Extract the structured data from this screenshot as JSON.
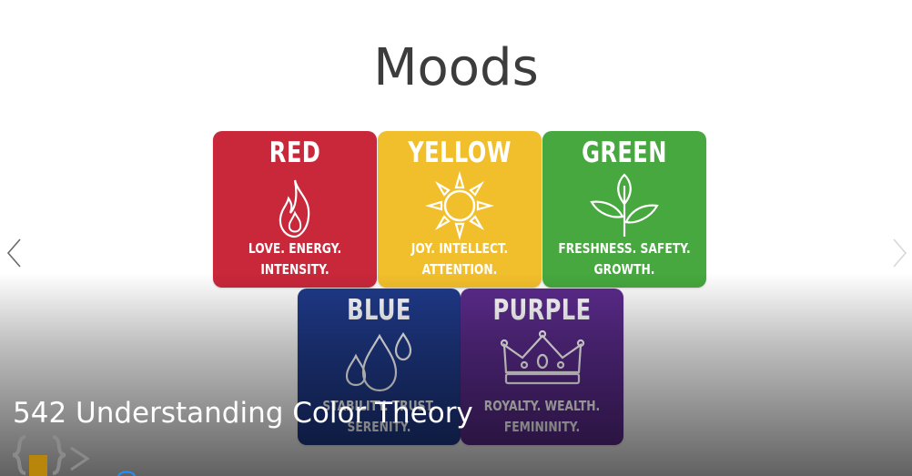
{
  "slide": {
    "title": "Moods",
    "tiles": [
      {
        "name": "RED",
        "desc_line1": "LOVE. ENERGY.",
        "desc_line2": "INTENSITY.",
        "color": "#c8283a",
        "icon": "flame-icon"
      },
      {
        "name": "YELLOW",
        "desc_line1": "JOY. INTELLECT.",
        "desc_line2": "ATTENTION.",
        "color": "#f2bf2c",
        "icon": "sun-icon"
      },
      {
        "name": "GREEN",
        "desc_line1": "FRESHNESS. SAFETY.",
        "desc_line2": "GROWTH.",
        "color": "#46a83e",
        "icon": "leaves-icon"
      },
      {
        "name": "BLUE",
        "desc_line1": "STABILITY. TRUST.",
        "desc_line2": "SERENITY.",
        "color": "#1f3a8a",
        "icon": "water-drops-icon"
      },
      {
        "name": "PURPLE",
        "desc_line1": "ROYALTY. WEALTH.",
        "desc_line2": "FEMININITY.",
        "color": "#5b2b8c",
        "icon": "crown-icon"
      }
    ]
  },
  "player": {
    "video_title": "542 Understanding Color Theory",
    "prev_icon": "chevron-left-icon",
    "next_icon": "chevron-right-icon",
    "logo_icon": "code-braces-logo-icon"
  }
}
